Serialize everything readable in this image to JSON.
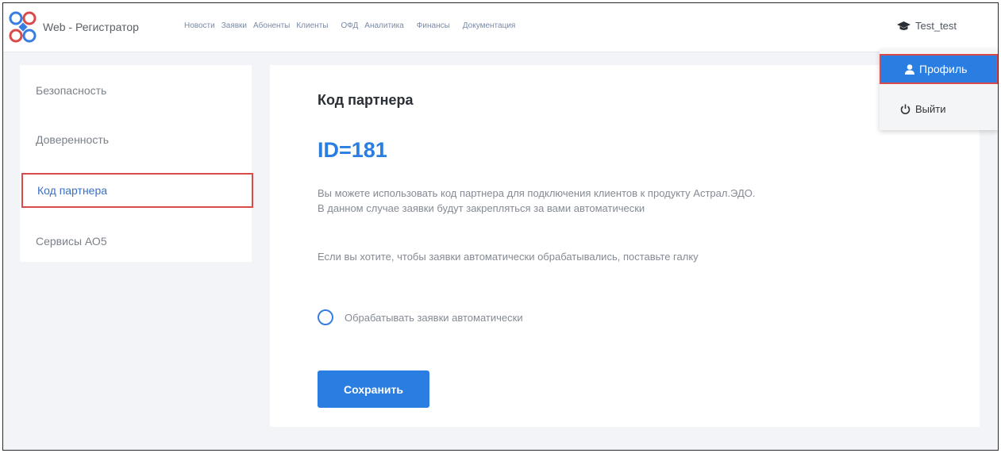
{
  "header": {
    "app_title": "Web - Регистратор",
    "nav": [
      "Новости",
      "Заявки",
      "Абоненты",
      "Клиенты",
      "ОФД",
      "Аналитика",
      "Финансы",
      "Документация"
    ],
    "user_name": "Test_test"
  },
  "user_menu": {
    "profile_label": "Профиль",
    "logout_label": "Выйти"
  },
  "sidebar": {
    "items": [
      {
        "label": "Безопасность"
      },
      {
        "label": "Доверенность"
      },
      {
        "label": "Код партнера"
      },
      {
        "label": "Сервисы АО5"
      }
    ],
    "active_index": 2
  },
  "main": {
    "title": "Код партнера",
    "partner_id": "ID=181",
    "desc_line1": "Вы можете использовать код партнера для подключения клиентов к продукту Астрал.ЭДО.",
    "desc_line2": "В данном случае заявки будут закрепляться за вами автоматически",
    "hint": "Если вы хотите, чтобы заявки автоматически обрабатывались, поставьте галку",
    "auto_label": "Обрабатывать заявки автоматически",
    "save_label": "Сохранить"
  },
  "colors": {
    "accent": "#2a7de1",
    "highlight": "#d94a4a",
    "muted_text": "#858b94",
    "background": "#f2f4f7"
  },
  "icons": {
    "logo": "app-logo",
    "user": "graduation-cap-icon",
    "profile": "person-icon",
    "logout": "power-icon",
    "checkbox": "radio-circle"
  }
}
